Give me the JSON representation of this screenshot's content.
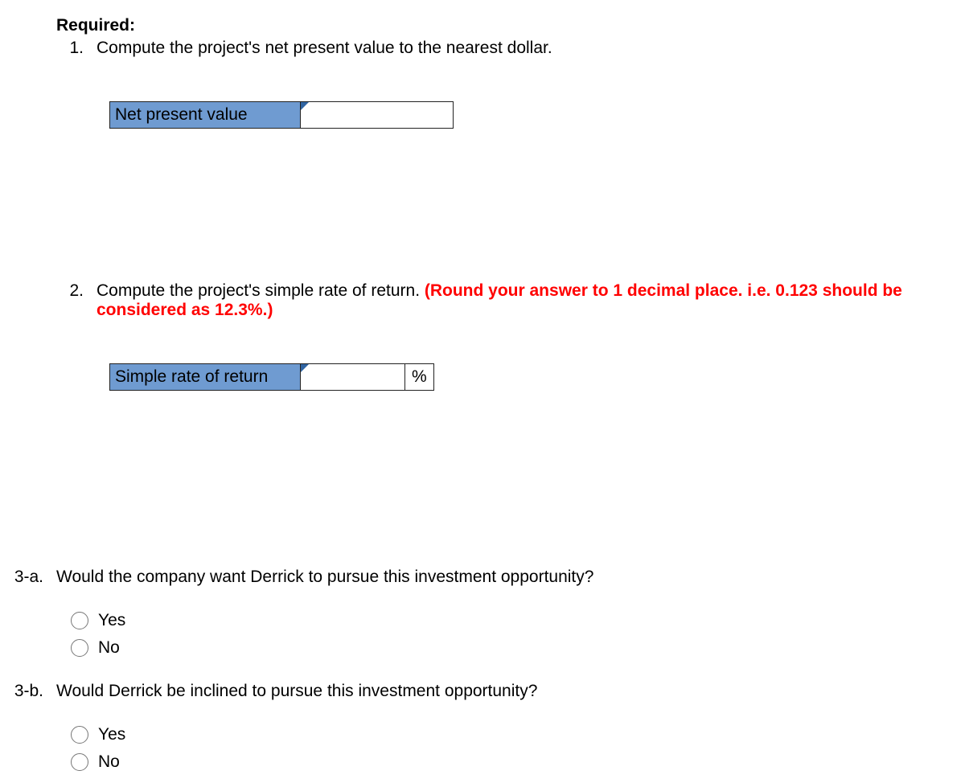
{
  "heading": "Required:",
  "q1": {
    "number": "1.",
    "text": "Compute the project's net present value to the nearest dollar.",
    "field_label": "Net present value",
    "field_value": ""
  },
  "q2": {
    "number": "2.",
    "text_plain": "Compute the project's simple rate of return. ",
    "text_red": "(Round your answer to 1 decimal place. i.e. 0.123 should be considered as 12.3%.)",
    "field_label": "Simple rate of return",
    "field_value": "",
    "unit": "%"
  },
  "q3a": {
    "number": "3-a.",
    "text": "Would the company want Derrick to pursue this investment opportunity?",
    "options": {
      "yes": "Yes",
      "no": "No"
    }
  },
  "q3b": {
    "number": "3-b.",
    "text": "Would Derrick be inclined to pursue this investment opportunity?",
    "options": {
      "yes": "Yes",
      "no": "No"
    }
  }
}
